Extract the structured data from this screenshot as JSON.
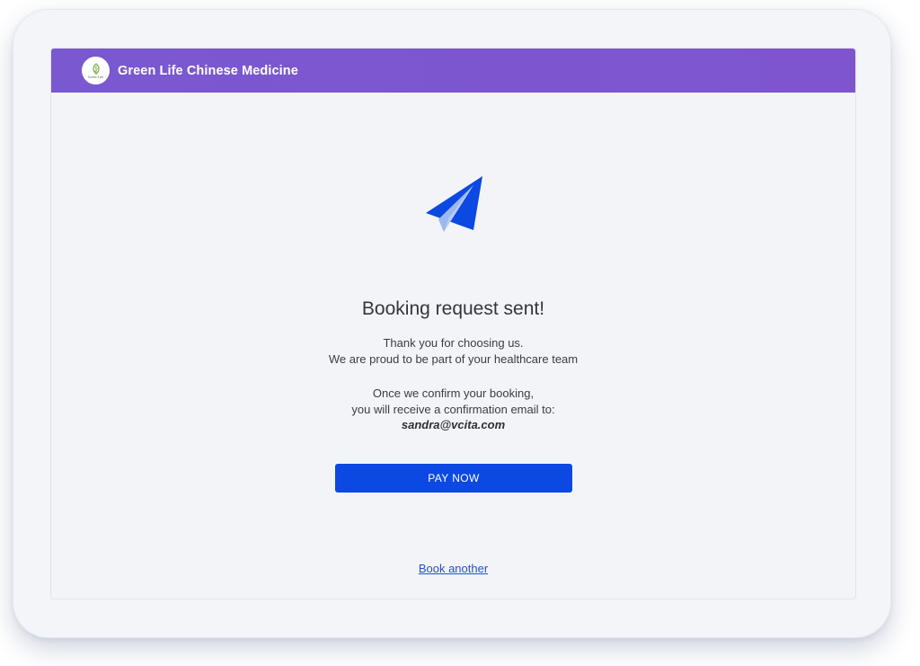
{
  "brand": {
    "name": "Green Life Chinese Medicine",
    "logo_text": "Green Life",
    "logo_icon": "leaf-icon"
  },
  "confirmation": {
    "icon": "paper-plane-icon",
    "title": "Booking request sent!",
    "thanks_line1": "Thank you for choosing us.",
    "thanks_line2": "We are proud to be part of your healthcare team",
    "confirm_line1": "Once we confirm your booking,",
    "confirm_line2": "you will receive a confirmation email to:",
    "email": "sandra@vcita.com"
  },
  "actions": {
    "pay_label": "PAY NOW",
    "book_another_label": "Book another"
  },
  "colors": {
    "header": "#7b57cf",
    "primary_button": "#0c48e2",
    "link": "#2350d3",
    "plane_dark": "#0c48e2",
    "plane_light": "#9db8ef"
  }
}
